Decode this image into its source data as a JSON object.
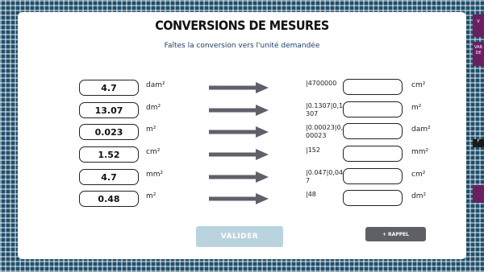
{
  "title": "CONVERSIONS DE MESURES",
  "subtitle": "Faîtes la conversion vers l'unité demandée",
  "rows": [
    {
      "value": "4.7",
      "from_unit": "dam²",
      "typed": "|4700000",
      "to_unit": "cm²"
    },
    {
      "value": "13.07",
      "from_unit": "dm²",
      "typed": "|0.1307|0,1307",
      "to_unit": "m²"
    },
    {
      "value": "0.023",
      "from_unit": "m²",
      "typed": "|0.00023|0,00023",
      "to_unit": "dam²"
    },
    {
      "value": "1.52",
      "from_unit": "cm²",
      "typed": "|152",
      "to_unit": "mm²"
    },
    {
      "value": "4.7",
      "from_unit": "mm²",
      "typed": "|0.047|0,047",
      "to_unit": "cm²"
    },
    {
      "value": "0.48",
      "from_unit": "m²",
      "typed": "|48",
      "to_unit": "dm²"
    }
  ],
  "buttons": {
    "valider": "VALIDER",
    "rappel": "+ RAPPEL"
  },
  "side_tabs": [
    "V",
    "VAR DE",
    "F"
  ],
  "colors": {
    "background": "#1f4f6b",
    "arrow": "#5f6168",
    "valider_button": "#b9d3df",
    "rappel_button": "#5e6066",
    "side_tab": "#6a1f63"
  }
}
